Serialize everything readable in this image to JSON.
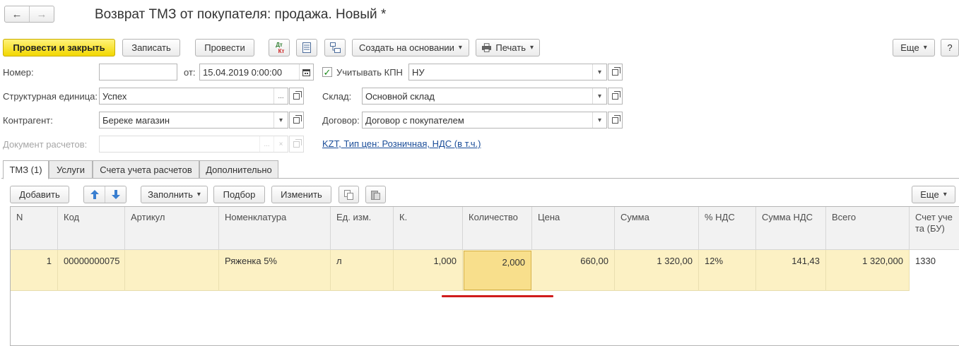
{
  "window": {
    "title": "Возврат ТМЗ от покупателя: продажа. Новый *",
    "back_icon": "←",
    "forward_icon": "→"
  },
  "toolbar": {
    "post_close": "Провести и закрыть",
    "save": "Записать",
    "post": "Провести",
    "dtkt_top": "Дт",
    "dtkt_bottom": "Кт",
    "create_based": "Создать на основании",
    "print": "Печать",
    "more": "Еще",
    "help": "?"
  },
  "form": {
    "number_label": "Номер:",
    "number_value": "",
    "date_label": "от:",
    "date_value": "15.04.2019  0:00:00",
    "kpn_label": "Учитывать КПН",
    "kpn_checked": "✓",
    "kpn_value": "НУ",
    "struct_label": "Структурная единица:",
    "struct_value": "Успех",
    "warehouse_label": "Склад:",
    "warehouse_value": "Основной склад",
    "contractor_label": "Контрагент:",
    "contractor_value": "Береке магазин",
    "contract_label": "Договор:",
    "contract_value": "Договор с покупателем",
    "settlement_doc_label": "Документ расчетов:",
    "settlement_doc_value": "",
    "price_link": "KZT, Тип цен: Розничная, НДС (в т.ч.)"
  },
  "tabs": [
    {
      "label": "ТМЗ (1)"
    },
    {
      "label": "Услуги"
    },
    {
      "label": "Счета учета расчетов"
    },
    {
      "label": "Дополнительно"
    }
  ],
  "table_toolbar": {
    "add": "Добавить",
    "fill": "Заполнить",
    "pick": "Подбор",
    "change": "Изменить",
    "more": "Еще"
  },
  "table": {
    "columns": [
      "N",
      "Код",
      "Артикул",
      "Номенклатура",
      "Ед. изм.",
      "К.",
      "Количество",
      "Цена",
      "Сумма",
      "% НДС",
      "Сумма НДС",
      "Всего",
      "Счет учета (БУ)"
    ],
    "rows": [
      {
        "n": "1",
        "code": "00000000075",
        "article": "",
        "item": "Ряженка 5%",
        "unit": "л",
        "k": "1,000",
        "qty": "2,000",
        "price": "660,00",
        "sum": "1 320,00",
        "vat_rate": "12%",
        "vat_sum": "141,43",
        "total": "1 320,000",
        "account": "1330"
      }
    ]
  },
  "colors": {
    "primary_button": "#f2d700",
    "row_highlight": "#fcf1c4",
    "cell_selected": "#f8df8c",
    "link": "#1a4d99",
    "annotation_red": "#d01c1c"
  }
}
